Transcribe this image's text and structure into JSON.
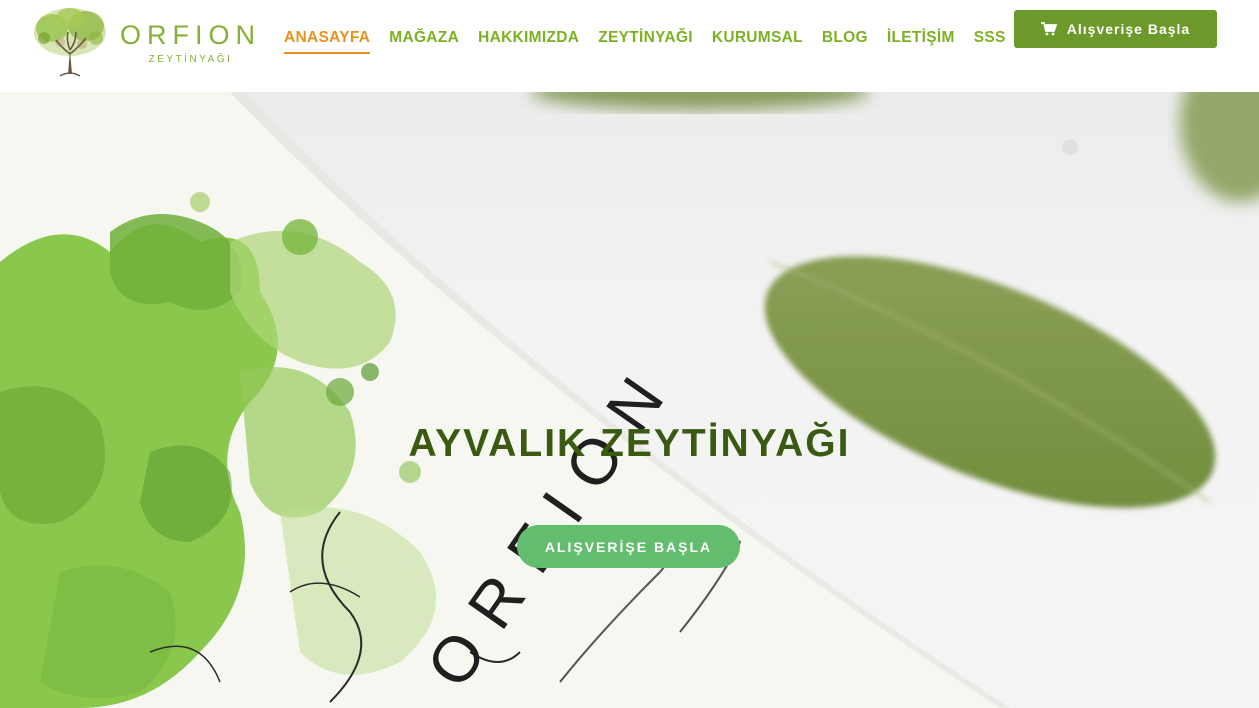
{
  "brand": {
    "name": "ORFION",
    "subtitle": "ZEYTİNYAĞI"
  },
  "nav": {
    "items": [
      {
        "label": "ANASAYFA",
        "active": true
      },
      {
        "label": "MAĞAZA"
      },
      {
        "label": "HAKKIMIZDA"
      },
      {
        "label": "ZEYTİNYAĞI"
      },
      {
        "label": "KURUMSAL"
      },
      {
        "label": "BLOG"
      },
      {
        "label": "İLETİŞİM"
      },
      {
        "label": "SSS"
      }
    ]
  },
  "header": {
    "shop_button_label": "Alışverişe Başla",
    "shop_button_icon": "cart-icon"
  },
  "hero": {
    "title": "AYVALIK ZEYTİNYAĞI",
    "button_label": "ALIŞVERİŞE BAŞLA",
    "label_brand_text": "ORFION"
  },
  "colors": {
    "nav_text": "#7db022",
    "nav_active": "#e8921e",
    "header_button": "#6c9a2a",
    "hero_button": "#62bd6e",
    "hero_title": "#3a5a12"
  }
}
